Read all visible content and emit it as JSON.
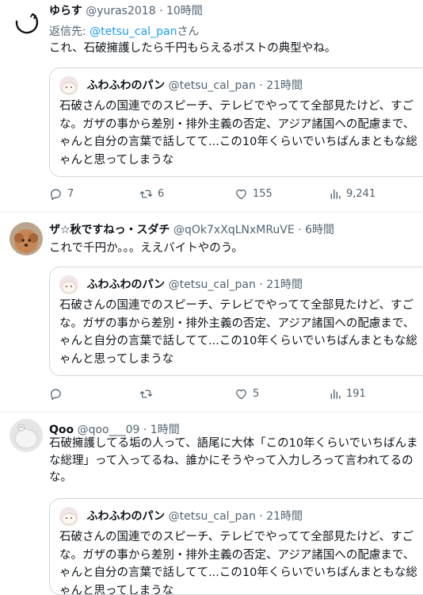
{
  "tweets": [
    {
      "name": "ゆらす",
      "handle": "@yuras2018",
      "time": "· 10時間",
      "reply_prefix": "返信先: ",
      "reply_to": "@tetsu_cal_pan",
      "reply_suffix": "さん",
      "text": "これ、石破擁護したら千円もらえるポストの典型やね。",
      "replies": "7",
      "retweets": "6",
      "likes": "155",
      "views": "9,241"
    },
    {
      "name": "ザ☆秋ですねっ・スダチ",
      "handle": "@qOk7xXqLNxMRuVE",
      "time": "· 6時間",
      "text": "これで千円か。。。ええバイトやのう。",
      "replies": "",
      "retweets": "",
      "likes": "5",
      "views": "191"
    },
    {
      "name": "Qoo",
      "handle": "@qoo___09",
      "time": "· 1時間",
      "text_lines": [
        "石破擁護してる垢の人って、語尾に大体「この10年くらいでいちばんま",
        "な総理」って入ってるね、誰かにそうやって入力しろって言われてるの",
        "な。"
      ]
    }
  ],
  "quoted": {
    "name": "ふわふわのパン",
    "handle": "@tetsu_cal_pan",
    "time": "· 21時間",
    "lines": [
      "石破さんの国連でのスピーチ、テレビでやってて全部見たけど、すご",
      "な。ガザの事から差別・排外主義の否定、アジア諸国への配慮まで、",
      "ゃんと自分の言葉で話してて...この10年くらいでいちばんまともな総",
      "ゃんと思ってしまうな"
    ]
  },
  "icons": {
    "reply": "reply-icon",
    "retweet": "retweet-icon",
    "like": "heart-icon",
    "views": "views-icon"
  },
  "colors": {
    "link": "#1d9bf0",
    "secondary_text": "#536471",
    "border": "#cfd9de"
  }
}
